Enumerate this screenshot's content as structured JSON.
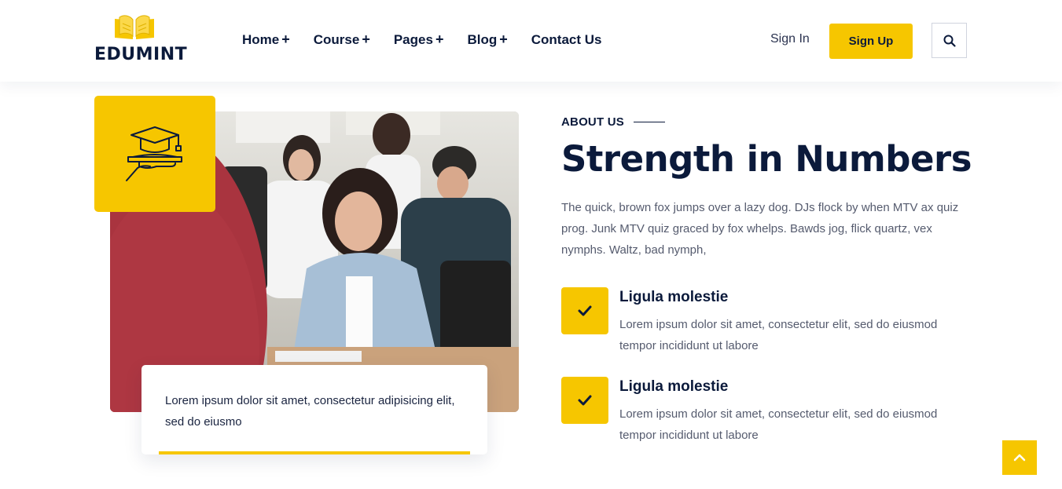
{
  "brand": {
    "name": "EDUMINT",
    "accent": "#f6c600",
    "navy": "#0b1a3b"
  },
  "nav": [
    {
      "label": "Home",
      "suffix": "+"
    },
    {
      "label": "Course",
      "suffix": "+"
    },
    {
      "label": "Pages",
      "suffix": "+"
    },
    {
      "label": "Blog",
      "suffix": "+"
    },
    {
      "label": "Contact Us",
      "suffix": ""
    }
  ],
  "auth": {
    "signin": "Sign In",
    "signup": "Sign Up"
  },
  "icons": {
    "search": "search-icon",
    "graduation": "graduation-cap-hand-icon",
    "check": "check-icon",
    "up": "chevron-up-icon"
  },
  "quote": {
    "text": "Lorem ipsum dolor sit amet, consectetur adipisicing elit, sed do eiusmo"
  },
  "about": {
    "eyebrow": "ABOUT US",
    "heading": "Strength in Numbers",
    "intro": "The quick, brown fox jumps over a lazy dog. DJs flock by when MTV ax quiz prog. Junk MTV quiz graced by fox whelps. Bawds jog, flick quartz, vex nymphs. Waltz, bad nymph,",
    "features": [
      {
        "title": "Ligula molestie",
        "desc": "Lorem ipsum dolor sit amet, consectetur elit, sed do eiusmod tempor incididunt ut labore"
      },
      {
        "title": "Ligula molestie",
        "desc": "Lorem ipsum dolor sit amet, consectetur elit, sed do eiusmod tempor incididunt ut labore"
      }
    ]
  }
}
